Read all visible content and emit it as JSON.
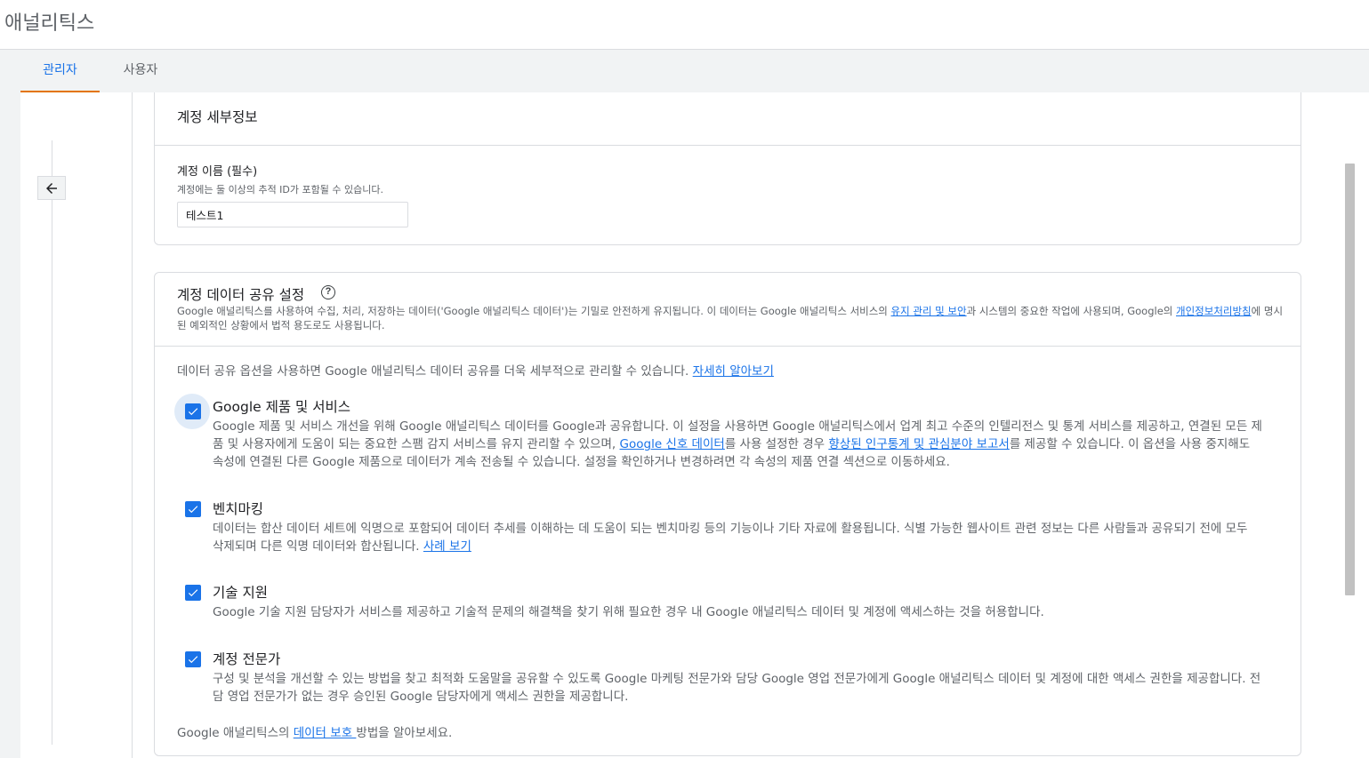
{
  "app": {
    "title": "애널리틱스"
  },
  "tabs": [
    {
      "label": "관리자",
      "active": true
    },
    {
      "label": "사용자",
      "active": false
    }
  ],
  "account_details": {
    "title": "계정 세부정보",
    "name_label": "계정 이름 (필수)",
    "name_help": "계정에는 둘 이상의 추적 ID가 포함될 수 있습니다.",
    "name_value": "테스트1"
  },
  "data_sharing": {
    "title": "계정 데이터 공유 설정",
    "desc_1": "Google 애널리틱스를 사용하여 수집, 처리, 저장하는 데이터('Google 애널리틱스 데이터')는 기밀로 안전하게 유지됩니다. 이 데이터는 Google 애널리틱스 서비스의 ",
    "desc_link_1": "유지 관리 및 보안",
    "desc_2": "과 시스템의 중요한 작업에 사용되며, Google의 ",
    "desc_link_2": "개인정보처리방침",
    "desc_3": "에 명시된 예외적인 상황에서 법적 용도로도 사용됩니다.",
    "intro": "데이터 공유 옵션을 사용하면 Google 애널리틱스 데이터 공유를 더욱 세부적으로 관리할 수 있습니다. ",
    "intro_link": "자세히 알아보기",
    "options": [
      {
        "title": "Google 제품 및 서비스",
        "checked": true,
        "desc_1": "Google 제품 및 서비스 개선을 위해 Google 애널리틱스 데이터를 Google과 공유합니다. 이 설정을 사용하면 Google 애널리틱스에서 업계 최고 수준의 인텔리전스 및 통계 서비스를 제공하고, 연결된 모든 제품 및 사용자에게 도움이 되는 중요한 스팸 감지 서비스를 유지 관리할 수 있으며, ",
        "link_1": "Google 신호 데이터",
        "desc_2": "를 사용 설정한 경우 ",
        "link_2": "향상된 인구통계 및 관심분야 보고서",
        "desc_3": "를 제공할 수 있습니다. 이 옵션을 사용 중지해도 속성에 연결된 다른 Google 제품으로 데이터가 계속 전송될 수 있습니다. 설정을 확인하거나 변경하려면 각 속성의 제품 연결 섹션으로 이동하세요."
      },
      {
        "title": "벤치마킹",
        "checked": true,
        "desc_1": "데이터는 합산 데이터 세트에 익명으로 포함되어 데이터 추세를 이해하는 데 도움이 되는 벤치마킹 등의 기능이나 기타 자료에 활용됩니다. 식별 가능한 웹사이트 관련 정보는 다른 사람들과 공유되기 전에 모두 삭제되며 다른 익명 데이터와 합산됩니다.  ",
        "link_1": "사례 보기"
      },
      {
        "title": "기술 지원",
        "checked": true,
        "desc_1": "Google 기술 지원 담당자가 서비스를 제공하고 기술적 문제의 해결책을 찾기 위해 필요한 경우 내 Google 애널리틱스 데이터 및 계정에 액세스하는 것을 허용합니다."
      },
      {
        "title": "계정 전문가",
        "checked": true,
        "desc_1": "구성 및 분석을 개선할 수 있는 방법을 찾고 최적화 도움말을 공유할 수 있도록 Google 마케팅 전문가와 담당 Google 영업 전문가에게 Google 애널리틱스 데이터 및 계정에 대한 액세스 권한을 제공합니다. 전담 영업 전문가가 없는 경우 승인된 Google 담당자에게 액세스 권한을 제공합니다."
      }
    ],
    "footer_1": "Google 애널리틱스의 ",
    "footer_link": "데이터 보호 ",
    "footer_2": "방법을 알아보세요."
  },
  "colors": {
    "accent": "#1a73e8",
    "tab_indicator": "#e37400"
  },
  "icons": {
    "back": "arrow-left-icon",
    "help": "help-circle-icon",
    "check": "checkmark-icon"
  }
}
